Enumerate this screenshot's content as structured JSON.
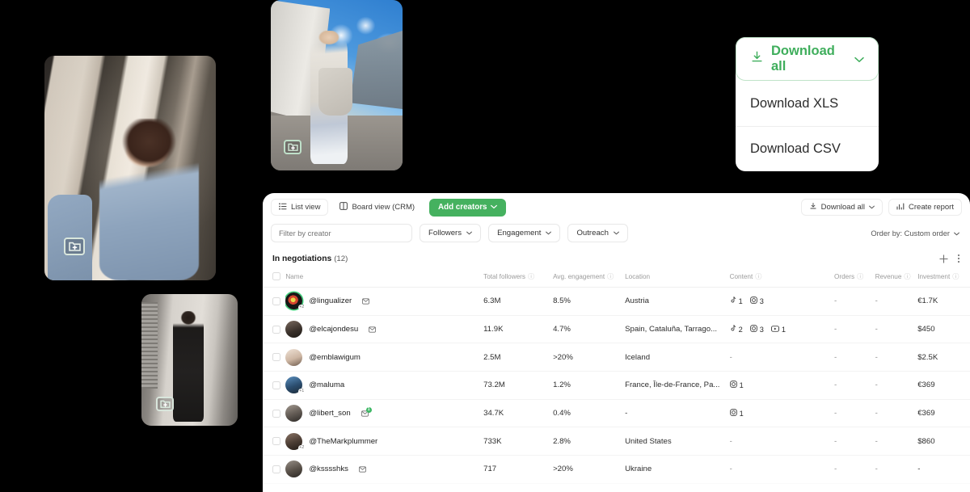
{
  "download_menu": {
    "trigger_label": "Download all",
    "trigger_icon": "download-icon",
    "chevron": "⌄",
    "items": [
      {
        "label": "Download XLS"
      },
      {
        "label": "Download CSV"
      }
    ],
    "accent_color": "#3fae5c"
  },
  "photos": [
    {
      "name": "photo-card-denim-woman",
      "overlay_icon": "add-to-folder-icon"
    },
    {
      "name": "photo-card-street-style",
      "overlay_icon": "add-to-folder-icon"
    },
    {
      "name": "photo-card-black-outfit",
      "overlay_icon": "add-to-folder-icon"
    }
  ],
  "toolbar": {
    "list_view_label": "List view",
    "list_view_icon": "list-icon",
    "board_view_label": "Board view (CRM)",
    "board_view_icon": "board-icon",
    "add_creators_label": "Add creators",
    "add_creators_chevron": "⌄",
    "download_all_label": "Download all",
    "download_all_icon": "download-icon",
    "download_all_chevron": "⌄",
    "create_report_label": "Create report",
    "create_report_icon": "chart-icon",
    "accent_color": "#45b15f"
  },
  "filters": {
    "search_placeholder": "Filter by creator",
    "search_value": "",
    "pills": [
      {
        "label": "Followers",
        "chevron": "⌄"
      },
      {
        "label": "Engagement",
        "chevron": "⌄"
      },
      {
        "label": "Outreach",
        "chevron": "⌄"
      }
    ],
    "order_by_label": "Order by: Custom order",
    "order_by_chevron": "⌄"
  },
  "group": {
    "title": "In negotiations",
    "count": "(12)",
    "add_icon": "plus-icon",
    "more_icon": "more-vertical-icon"
  },
  "table": {
    "columns": [
      {
        "key": "checkbox",
        "label": "",
        "info": false
      },
      {
        "key": "name",
        "label": "Name",
        "info": false
      },
      {
        "key": "followers",
        "label": "Total followers",
        "info": true
      },
      {
        "key": "engagement",
        "label": "Avg. engagement",
        "info": true
      },
      {
        "key": "location",
        "label": "Location",
        "info": false
      },
      {
        "key": "content",
        "label": "Content",
        "info": true
      },
      {
        "key": "orders",
        "label": "Orders",
        "info": true
      },
      {
        "key": "revenue",
        "label": "Revenue",
        "info": true
      },
      {
        "key": "investment",
        "label": "Investment",
        "info": true
      }
    ],
    "info_glyph": "ⓘ",
    "rows": [
      {
        "handle": "@lingualizer",
        "avatar_ring": true,
        "avatar_badge": "+2",
        "message_icon": "message-icon",
        "message_badge": "",
        "followers": "6.3M",
        "engagement": "8.5%",
        "location": "Austria",
        "content": [
          {
            "icon": "tiktok-icon",
            "count": "1"
          },
          {
            "icon": "instagram-icon",
            "count": "3"
          }
        ],
        "orders": "-",
        "revenue": "-",
        "investment": "€1.7K"
      },
      {
        "handle": "@elcajondesu",
        "avatar_ring": false,
        "avatar_badge": "",
        "message_icon": "message-icon",
        "message_badge": "",
        "followers": "11.9K",
        "engagement": "4.7%",
        "location": "Spain, Cataluña, Tarrago...",
        "content": [
          {
            "icon": "tiktok-icon",
            "count": "2"
          },
          {
            "icon": "instagram-icon",
            "count": "3"
          },
          {
            "icon": "youtube-icon",
            "count": "1"
          }
        ],
        "orders": "-",
        "revenue": "-",
        "investment": "$450"
      },
      {
        "handle": "@emblawigum",
        "avatar_ring": false,
        "avatar_badge": "",
        "message_icon": "",
        "message_badge": "",
        "followers": "2.5M",
        "engagement": ">20%",
        "location": "Iceland",
        "content": [],
        "orders": "-",
        "revenue": "-",
        "investment": "$2.5K"
      },
      {
        "handle": "@maluma",
        "avatar_ring": false,
        "avatar_badge": "+1",
        "message_icon": "",
        "message_badge": "",
        "followers": "73.2M",
        "engagement": "1.2%",
        "location": "France, Île-de-France, Pa...",
        "content": [
          {
            "icon": "instagram-icon",
            "count": "1"
          }
        ],
        "orders": "-",
        "revenue": "-",
        "investment": "€369"
      },
      {
        "handle": "@libert_son",
        "avatar_ring": false,
        "avatar_badge": "",
        "message_icon": "message-icon",
        "message_badge": "1",
        "followers": "34.7K",
        "engagement": "0.4%",
        "location": "-",
        "content": [
          {
            "icon": "instagram-icon",
            "count": "1"
          }
        ],
        "orders": "-",
        "revenue": "-",
        "investment": "€369"
      },
      {
        "handle": "@TheMarkplummer",
        "avatar_ring": false,
        "avatar_badge": "+2",
        "message_icon": "",
        "message_badge": "",
        "followers": "733K",
        "engagement": "2.8%",
        "location": "United States",
        "content": [],
        "orders": "-",
        "revenue": "-",
        "investment": "$860"
      },
      {
        "handle": "@ksssshks",
        "avatar_ring": false,
        "avatar_badge": "",
        "message_icon": "message-icon",
        "message_badge": "",
        "followers": "717",
        "engagement": ">20%",
        "location": "Ukraine",
        "content": [],
        "orders": "-",
        "revenue": "-",
        "investment": "-"
      }
    ]
  }
}
